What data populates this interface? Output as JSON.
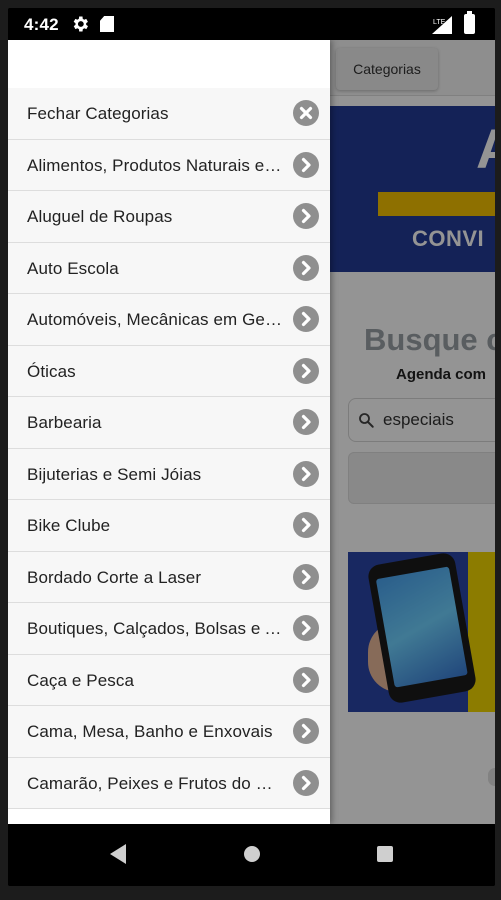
{
  "status_bar": {
    "time": "4:42",
    "icons": [
      "gear-icon",
      "sd-card-icon",
      "signal-icon",
      "battery-icon"
    ]
  },
  "background_page": {
    "categories_button": "Categorias",
    "banner_text": "CONVI",
    "banner_letter": "A",
    "heading": "Busque c",
    "subheading": "Agenda com",
    "search_value": "especiais"
  },
  "drawer": {
    "items": [
      {
        "label": "Fechar Categorias",
        "icon": "close-icon"
      },
      {
        "label": "Alimentos, Produtos Naturais e Suplementos",
        "icon": "chevron-right-icon"
      },
      {
        "label": "Aluguel de Roupas",
        "icon": "chevron-right-icon"
      },
      {
        "label": "Auto Escola",
        "icon": "chevron-right-icon"
      },
      {
        "label": "Automóveis, Mecânicas em Geral",
        "icon": "chevron-right-icon"
      },
      {
        "label": "Óticas",
        "icon": "chevron-right-icon"
      },
      {
        "label": "Barbearia",
        "icon": "chevron-right-icon"
      },
      {
        "label": "Bijuterias e Semi Jóias",
        "icon": "chevron-right-icon"
      },
      {
        "label": "Bike Clube",
        "icon": "chevron-right-icon"
      },
      {
        "label": "Bordado Corte a Laser",
        "icon": "chevron-right-icon"
      },
      {
        "label": "Boutiques, Calçados, Bolsas e Acessórios",
        "icon": "chevron-right-icon"
      },
      {
        "label": "Caça e Pesca",
        "icon": "chevron-right-icon"
      },
      {
        "label": "Cama, Mesa, Banho e Enxovais",
        "icon": "chevron-right-icon"
      },
      {
        "label": "Camarão, Peixes e Frutos do Mar",
        "icon": "chevron-right-icon"
      }
    ]
  },
  "nav_bar": {
    "icons": [
      "back-icon",
      "home-icon",
      "recents-icon"
    ]
  },
  "colors": {
    "banner_blue": "#243b96",
    "banner_yellow": "#f5c100",
    "arrow_gray": "#8f8f8f",
    "item_bg": "#f7f7f7"
  }
}
